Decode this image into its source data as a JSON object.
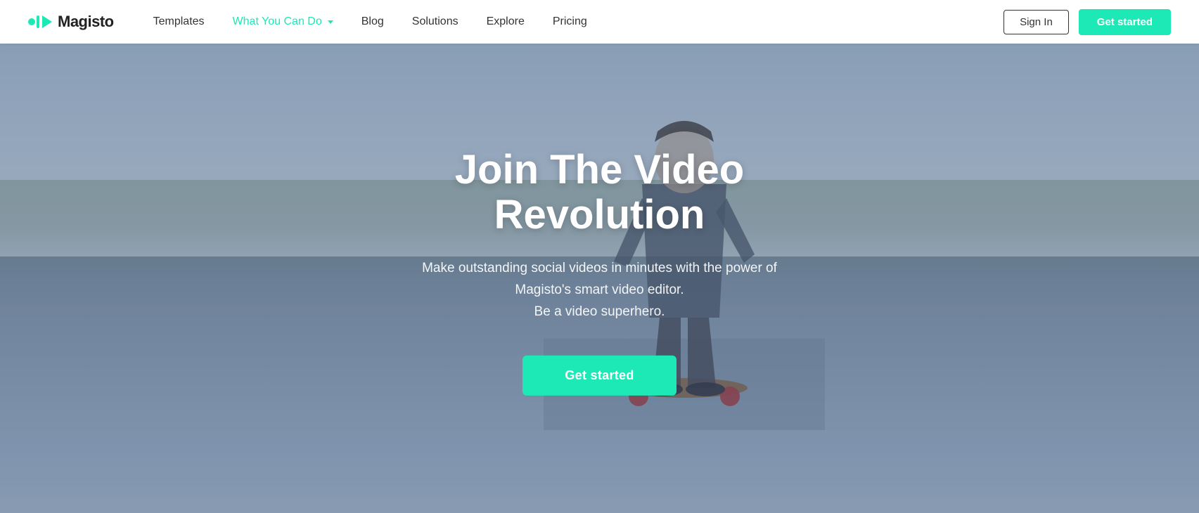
{
  "brand": {
    "name": "Magisto",
    "logo_alt": "Magisto logo"
  },
  "navbar": {
    "items": [
      {
        "label": "Templates",
        "active": false,
        "id": "templates"
      },
      {
        "label": "What You Can Do",
        "active": true,
        "id": "what-you-can-do",
        "hasChevron": true
      },
      {
        "label": "Blog",
        "active": false,
        "id": "blog"
      },
      {
        "label": "Solutions",
        "active": false,
        "id": "solutions"
      },
      {
        "label": "Explore",
        "active": false,
        "id": "explore"
      },
      {
        "label": "Pricing",
        "active": false,
        "id": "pricing"
      }
    ],
    "signin_label": "Sign In",
    "get_started_label": "Get started"
  },
  "hero": {
    "title": "Join The Video Revolution",
    "subtitle_line1": "Make outstanding social videos in minutes with the power of",
    "subtitle_line2": "Magisto's smart video editor.",
    "subtitle_line3": "Be a video superhero.",
    "cta_label": "Get started"
  }
}
